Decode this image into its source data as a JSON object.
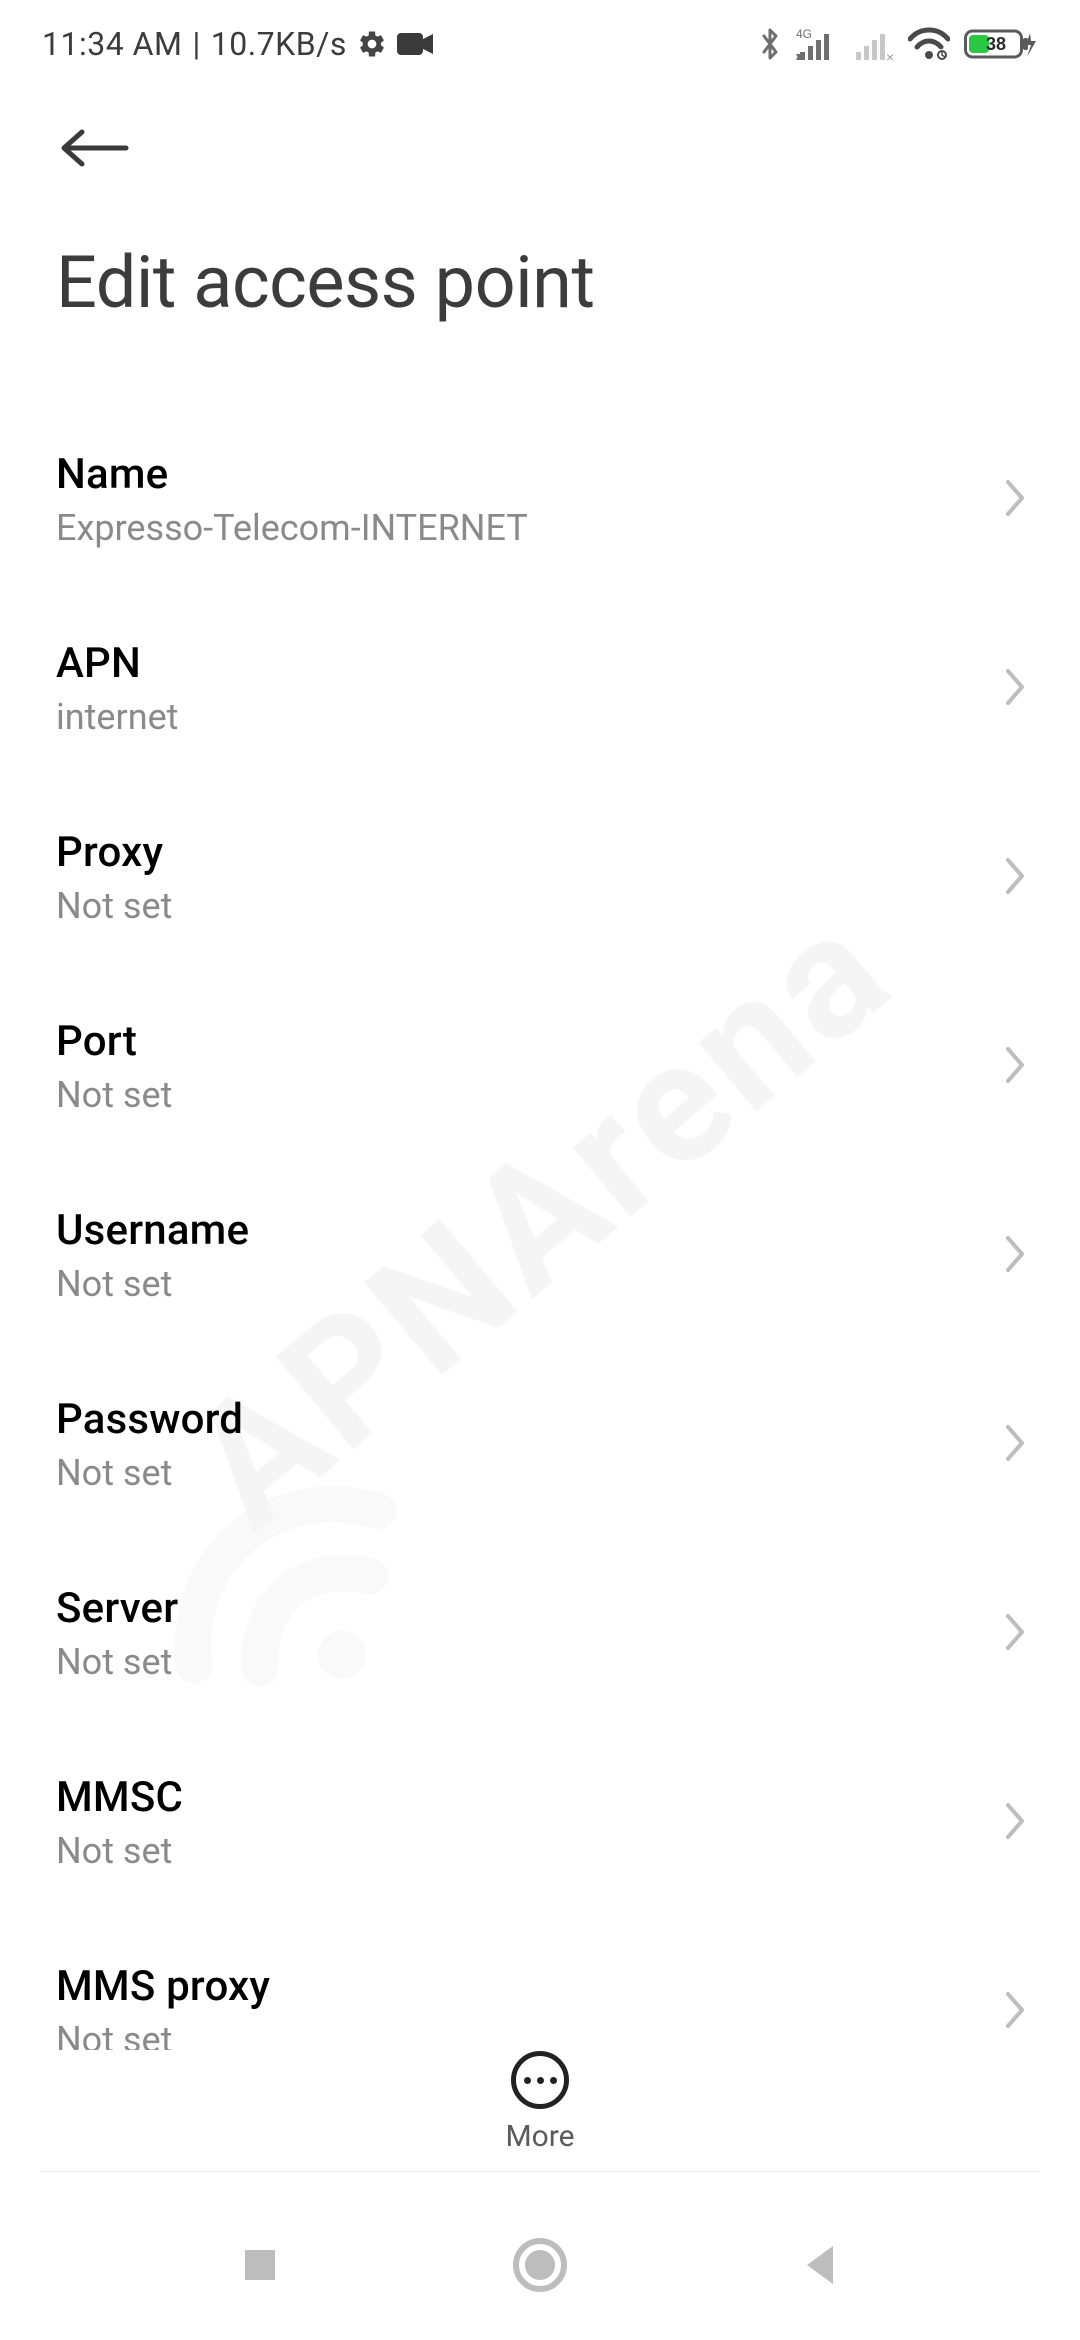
{
  "status": {
    "time": "11:34 AM",
    "sep": " | ",
    "net_speed": "10.7KB/s",
    "battery_percent": "38"
  },
  "header": {
    "title": "Edit access point"
  },
  "fields": [
    {
      "label": "Name",
      "value": "Expresso-Telecom-INTERNET"
    },
    {
      "label": "APN",
      "value": "internet"
    },
    {
      "label": "Proxy",
      "value": "Not set"
    },
    {
      "label": "Port",
      "value": "Not set"
    },
    {
      "label": "Username",
      "value": "Not set"
    },
    {
      "label": "Password",
      "value": "Not set"
    },
    {
      "label": "Server",
      "value": "Not set"
    },
    {
      "label": "MMSC",
      "value": "Not set"
    },
    {
      "label": "MMS proxy",
      "value": "Not set"
    }
  ],
  "more_label": "More",
  "watermark": "APNArena"
}
